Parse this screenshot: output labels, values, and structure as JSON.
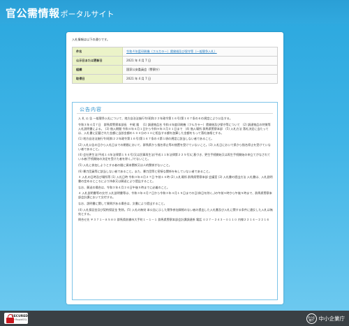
{
  "header": {
    "title_main": "官公需情報",
    "title_sub": "ポータルサイト"
  },
  "intro": "入札情報は以下の通りです。",
  "info_rows": [
    {
      "label": "件名",
      "value": "令和４年度印刷機（フルカラー）賃貸借及び保守等（一般競争入札）"
    },
    {
      "label": "公示日または更新日",
      "value": "2021 年 4 月 7 日"
    },
    {
      "label": "組織",
      "value": "国家公安委員会（警察庁）"
    },
    {
      "label": "取得日",
      "value": "2021 年 4 月 7 日"
    }
  ],
  "content": {
    "title": "公告内容",
    "paragraphs": [
      "入 札 公 告 一般競争入札について、地方自治法施行令(昭和２２年政令第１６号)第１６７条の６の規定により公告する。",
      "令和３年４月７日　群馬県警察本部長　中尾 隆 　(1) 調達物品名 令和４年度印刷機（フルカラー）賃貸借及び保守等について　(2) 調達物品の特質等 入札説明書による。　(3) 借入期間 令和４年４月１日から令和９年３月３１日まで　(4) 借入場所 群馬県警察本部　(5) 入札方法 落札決定に当たっては、入札書に記載された金額に当該金額の１００分の１０に相当する額を加算した金額をもって落札価格とする。",
      "(1) 地方自治法施行令(昭和２２年政令第１６号)第１６７条の４第１項の規定に該当しない者であること。",
      "(2) 入札公告の日から入札日までの期間において、群馬県から指名停止等の措置を受けていないこと。(3) 入札日において県から指名停止を受けていない者であること。",
      "(4) 会社更生法(平成１４年法律第１５４号)又は民事再生法(平成１１年法律第２２５号)に基づき、更生手続開始又は再生手続開始の申立てがなされている者(手続開始の決定を受けた者を除く。)でないこと。",
      "(5) 入札に参加しようとする者の間に資本関係又は人的関係がないこと。",
      "(6) 暴力団員等に該当しない者であること。また、暴力団等と密接な関係を有していない者であること。",
      "３ 入札の日時及び場所等 (1) 入札日時 令和３年４月２７日 午前１０時 (2) 入札場所 群馬県警察本部 会議室 (3) 入札書の提出方法 入札書は、入札説明書の定めるところにより持参又は郵送により提出すること。",
      "なお、郵送の場合は、令和３年４月２６日午後５時までに必着のこと。",
      "４ 入札説明書等の交付 入札説明書等は、令和３年４月７日から令和３年４月１５日までの日(休日を除く。)の午前９時から午後５時まで、群馬県警察本部会計課において交付する。",
      "なお、説明書に関して質問がある場合は、文書により提出すること。",
      "(4) 入札保証金及び契約保証金 免除。(5) 入札の無効 本公告に示した競争参加資格のない者の提出した入札書及び入札に関する条件に違反した入札は無効とする。",
      "問合せ先 〒３７１－８５８０ 群馬県前橋市大手町１－１－１ 群馬県警察本部会計課調達係 電話 ０２７－２４３－０１１０ 内線２２１４－２２１６"
    ]
  },
  "footer": {
    "secured_label": "SECURED",
    "secured_sub": "by RapidSSL",
    "agency_badge": "中小企業庁",
    "agency_name": "中小企業庁"
  },
  "colors": {
    "brand_blue": "#2aa7de",
    "label_bg": "#ebf3c8",
    "footer_bg": "#3a4044",
    "lock_red": "#c8161d"
  }
}
